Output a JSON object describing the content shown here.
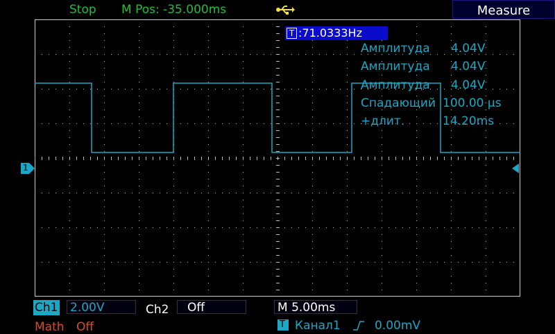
{
  "status": {
    "run_state": "Stop",
    "mpos": "M Pos: -35.000ms",
    "usb_icon": "usb-icon"
  },
  "menu": {
    "measure_label": "Measure"
  },
  "trigger_readout": {
    "label": "T",
    "value": ":71.0333Hz"
  },
  "measurements": [
    {
      "name": "Амплитуда",
      "value": "4.04V"
    },
    {
      "name": "Амплитуда",
      "value": "4.04V"
    },
    {
      "name": "Амплитуда",
      "value": "4.04V"
    },
    {
      "name": "Спадающий",
      "value": "100.00 µs"
    },
    {
      "name": "+длит.",
      "value": "14.20ms"
    }
  ],
  "markers": {
    "ch1_ground": "1"
  },
  "bottom": {
    "ch1": {
      "label": "Ch1",
      "value": "2.00V"
    },
    "ch2": {
      "label": "Ch2",
      "value": "Off"
    },
    "math": {
      "label": "Math",
      "value": "Off"
    },
    "timebase": "M 5.00ms",
    "trigger": {
      "icon_label": "T",
      "source": "Канал1",
      "level": "0.00mV"
    }
  },
  "colors": {
    "trace": "#1aa8c4",
    "accent_green": "#1fbf3a",
    "math_red": "#d84b28",
    "grid_dot": "#bbbbbb"
  }
}
